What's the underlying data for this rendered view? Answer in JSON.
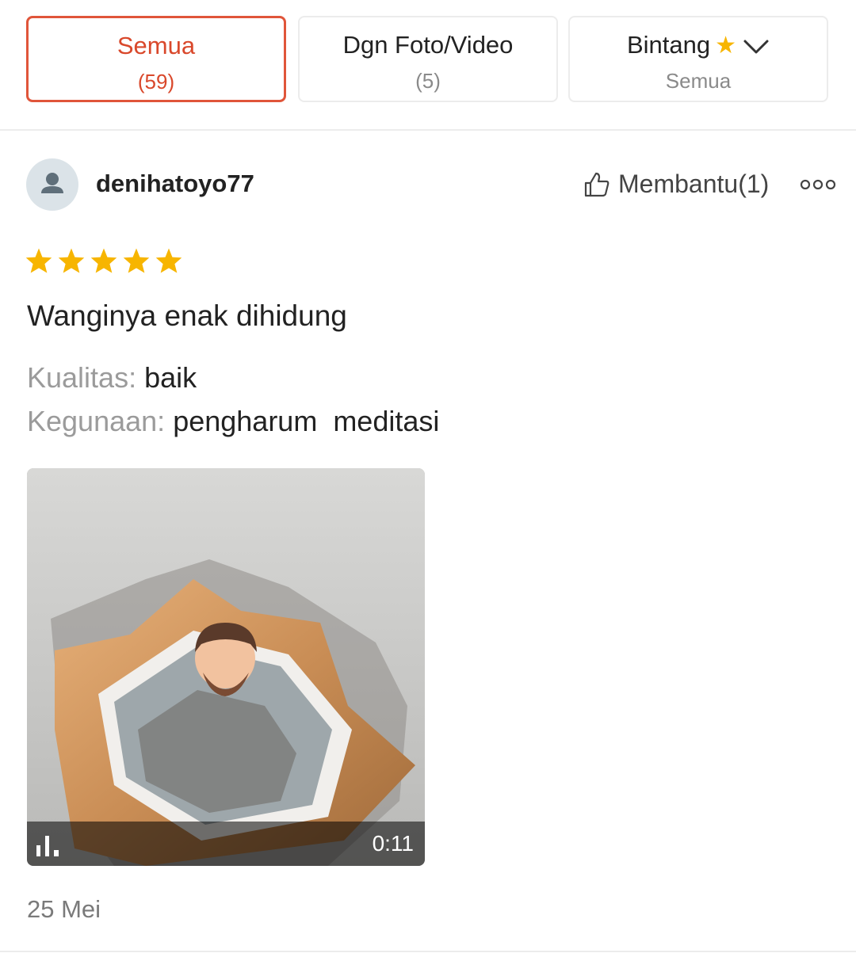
{
  "filters": {
    "all": {
      "label": "Semua",
      "count": "(59)"
    },
    "media": {
      "label": "Dgn Foto/Video",
      "count": "(5)"
    },
    "rating": {
      "label": "Bintang",
      "sub": "Semua",
      "icon": "star-icon",
      "dropdown_icon": "chevron-down-icon"
    }
  },
  "review": {
    "username": "denihatoyo77",
    "helpful_label": "Membantu(1)",
    "rating": 5,
    "text": "Wanginya enak dihidung",
    "attributes": [
      {
        "key": "Kualitas:",
        "value": "baik"
      },
      {
        "key": "Kegunaan:",
        "value": "pengharum  meditasi"
      }
    ],
    "media": {
      "type": "video",
      "duration": "0:11"
    },
    "date": "25 Mei"
  },
  "colors": {
    "accent": "#d9482b",
    "star": "#f7b500",
    "muted": "#8a8a8a"
  }
}
